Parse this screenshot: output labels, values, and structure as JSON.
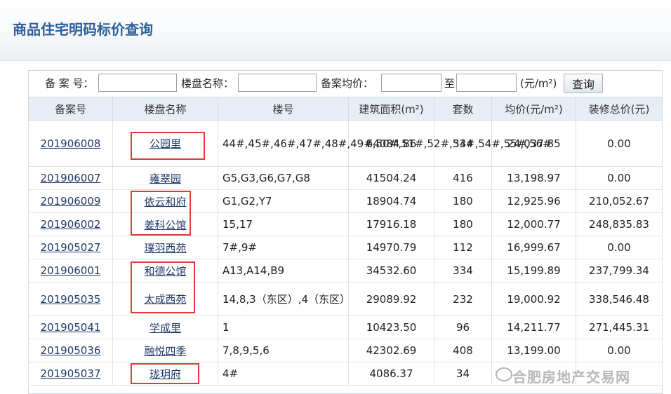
{
  "page": {
    "title": "商品住宅明码标价查询"
  },
  "search": {
    "record_label": "备 案 号：",
    "project_label": "楼盘名称：",
    "avg_label": "备案均价：",
    "to_label": "至",
    "unit_label": "(元/m²)",
    "button_label": "查询",
    "record_value": "",
    "project_value": "",
    "price_from_value": "",
    "price_to_value": ""
  },
  "table": {
    "headers": [
      "备案号",
      "楼盘名称",
      "楼号",
      "建筑面积(m²)",
      "套数",
      "均价(元/m²)",
      "装修总价(元)"
    ],
    "rows": [
      {
        "id": "201906008",
        "name": "公园里",
        "buildings": "44#,45#,46#,47#,48#,49#,50#,51#,52#,53#,54#,55#,56#",
        "area": "64084.86",
        "units": "344",
        "avg": "24,037.85",
        "reno": "0.00",
        "highlight": true
      },
      {
        "id": "201906007",
        "name": "雍翠园",
        "buildings": "G5,G3,G6,G7,G8",
        "area": "41504.24",
        "units": "416",
        "avg": "13,198.97",
        "reno": "0.00",
        "highlight": false
      },
      {
        "id": "201906009",
        "name": "依云和府",
        "buildings": "G1,G2,Y7",
        "area": "18904.74",
        "units": "180",
        "avg": "12,925.96",
        "reno": "210,052.67",
        "highlight": true
      },
      {
        "id": "201906002",
        "name": "姜科公馆",
        "buildings": "15,17",
        "area": "17916.18",
        "units": "180",
        "avg": "12,000.77",
        "reno": "248,835.83",
        "highlight": true
      },
      {
        "id": "201905027",
        "name": "璞羽西苑",
        "buildings": "7#,9#",
        "area": "14970.79",
        "units": "112",
        "avg": "16,999.67",
        "reno": "0.00",
        "highlight": false
      },
      {
        "id": "201906001",
        "name": "和德公馆",
        "buildings": "A13,A14,B9",
        "area": "34532.60",
        "units": "334",
        "avg": "15,199.89",
        "reno": "237,799.34",
        "highlight": true
      },
      {
        "id": "201905035",
        "name": "太成西苑",
        "buildings": "14,8,3（东区）,4（东区）",
        "area": "29089.92",
        "units": "232",
        "avg": "19,000.92",
        "reno": "338,546.48",
        "highlight": true
      },
      {
        "id": "201905041",
        "name": "学成里",
        "buildings": "1",
        "area": "10423.50",
        "units": "96",
        "avg": "14,211.77",
        "reno": "271,445.31",
        "highlight": false
      },
      {
        "id": "201905036",
        "name": "融悦四季",
        "buildings": "7,8,9,5,6",
        "area": "42302.69",
        "units": "408",
        "avg": "13,199.00",
        "reno": "0.00",
        "highlight": false
      },
      {
        "id": "201905037",
        "name": "珑玥府",
        "buildings": "4#",
        "area": "4086.37",
        "units": "34",
        "avg": "",
        "reno": "",
        "highlight": true
      }
    ]
  },
  "watermark": {
    "text": "合肥房地产交易网"
  },
  "colors": {
    "title": "#2d5f99",
    "header_bg": "#e6edf5",
    "link": "#1f3a6b",
    "highlight": "#e53935"
  }
}
